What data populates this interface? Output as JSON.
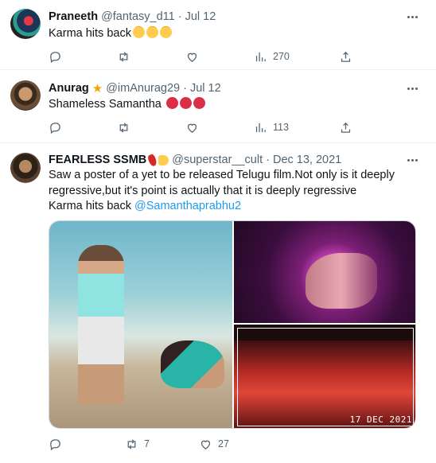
{
  "tweets": [
    {
      "name": "Praneeth",
      "handle": "@fantasy_d11",
      "date": "· Jul 12",
      "text": "Karma hits back",
      "emojis": [
        "rolling-on-floor-laughing",
        "rolling-on-floor-laughing",
        "rolling-on-floor-laughing"
      ],
      "views": "270",
      "replies": "",
      "retweets": "",
      "likes": ""
    },
    {
      "name": "Anurag",
      "badge": "star",
      "handle": "@imAnurag29",
      "date": "· Jul 12",
      "text": "Shameless Samantha ",
      "emojis": [
        "angry-face",
        "angry-face",
        "angry-face"
      ],
      "views": "113",
      "replies": "",
      "retweets": "",
      "likes": ""
    },
    {
      "name": "FEARLESS SSMB",
      "badges": [
        "chili-pepper",
        "thumbs-up"
      ],
      "handle": "@superstar__cult",
      "date": "· Dec 13, 2021",
      "text_line1": "Saw a poster of a yet to be released Telugu film.Not only is it deeply",
      "text_line2": "regressive,but it's point is actually that it is deeply regressive",
      "text_line3": "Karma hits back ",
      "mention": "@Samanthaprabhu2",
      "media_stamp": "17 DEC 2021",
      "replies": "",
      "retweets": "7",
      "likes": "27"
    }
  ],
  "colors": {
    "text": "#0f1419",
    "secondary": "#536471",
    "link": "#1d9bf0",
    "divider": "#eff3f4"
  },
  "icons": [
    "reply-icon",
    "retweet-icon",
    "like-icon",
    "views-icon",
    "share-icon",
    "more-icon"
  ]
}
